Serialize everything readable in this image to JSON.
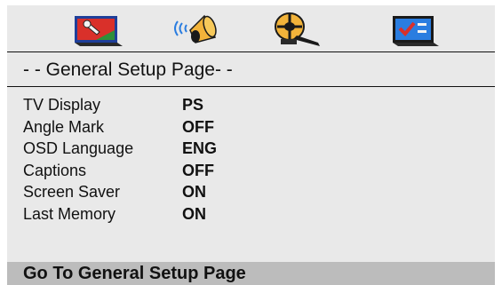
{
  "icons": [
    {
      "name": "general-setup-icon",
      "colors": [
        "#d9302a",
        "#1f3f9a",
        "#2f8f3a",
        "#f2d43a"
      ]
    },
    {
      "name": "audio-speaker-icon",
      "colors": [
        "#f2b33a",
        "#1a1a1a"
      ]
    },
    {
      "name": "video-reel-icon",
      "colors": [
        "#f2b33a",
        "#1a1a1a"
      ]
    },
    {
      "name": "preference-checklist-icon",
      "colors": [
        "#2a7de0",
        "#d9302a"
      ]
    }
  ],
  "page_title": "- - General Setup Page- -",
  "settings": [
    {
      "label": "TV Display",
      "value": "PS"
    },
    {
      "label": "Angle Mark",
      "value": "OFF"
    },
    {
      "label": "OSD Language",
      "value": "ENG"
    },
    {
      "label": "Captions",
      "value": "OFF"
    },
    {
      "label": "Screen Saver",
      "value": "ON"
    },
    {
      "label": "Last Memory",
      "value": "ON"
    }
  ],
  "status_bar": {
    "text": "Go To General Setup Page"
  }
}
